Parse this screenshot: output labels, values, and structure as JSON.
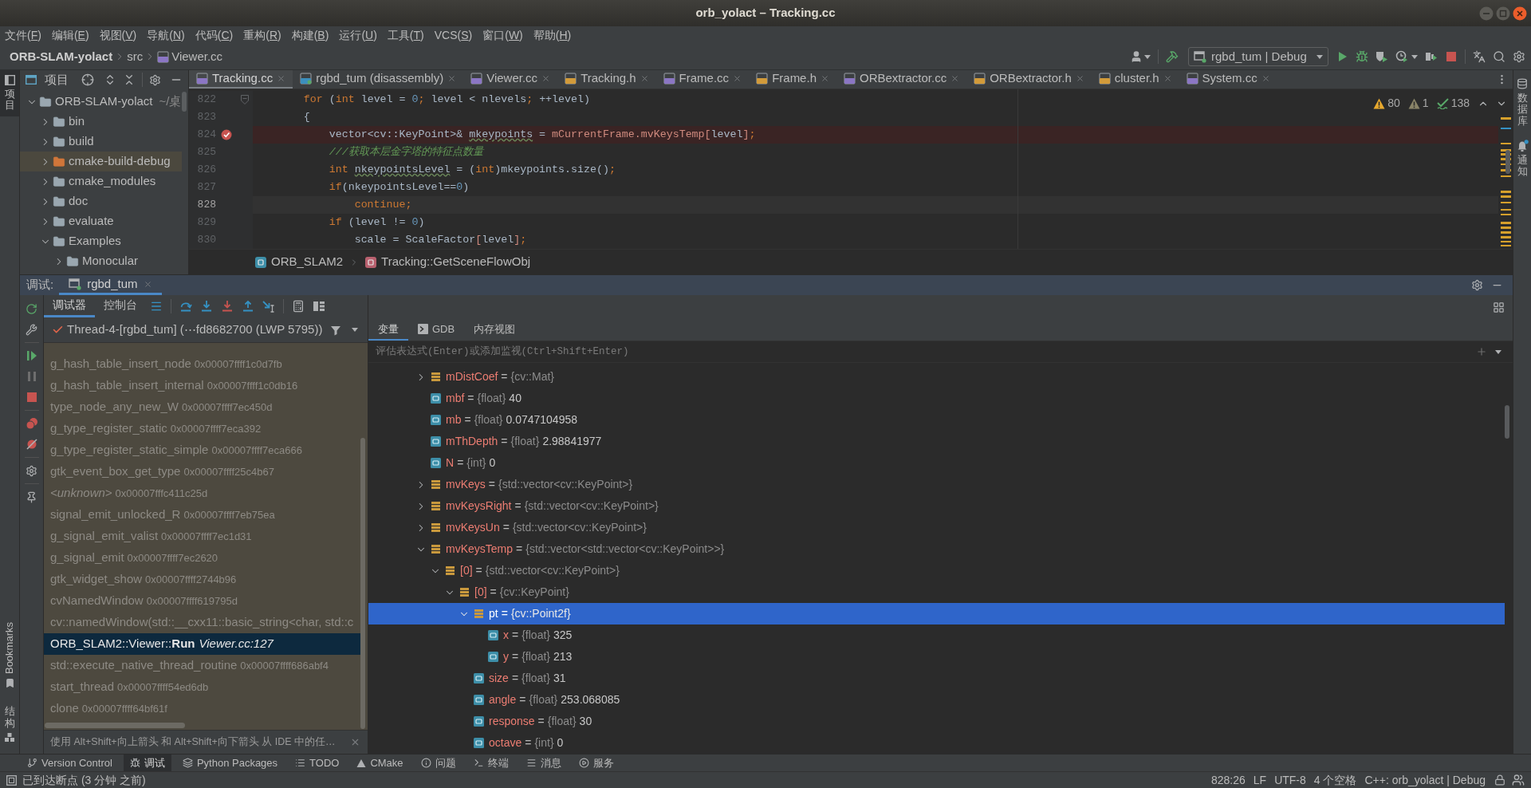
{
  "window": {
    "title": "orb_yolact – Tracking.cc"
  },
  "menu": [
    {
      "before": "文件(",
      "key": "F",
      "after": ")"
    },
    {
      "before": "编辑(",
      "key": "E",
      "after": ")"
    },
    {
      "before": "视图(",
      "key": "V",
      "after": ")"
    },
    {
      "before": "导航(",
      "key": "N",
      "after": ")"
    },
    {
      "before": "代码(",
      "key": "C",
      "after": ")"
    },
    {
      "before": "重构(",
      "key": "R",
      "after": ")"
    },
    {
      "before": "构建(",
      "key": "B",
      "after": ")"
    },
    {
      "before": "运行(",
      "key": "U",
      "after": ")"
    },
    {
      "before": "工具(",
      "key": "T",
      "after": ")"
    },
    {
      "before": "VCS(",
      "key": "S",
      "after": ")"
    },
    {
      "before": "窗口(",
      "key": "W",
      "after": ")"
    },
    {
      "before": "帮助(",
      "key": "H",
      "after": ")"
    }
  ],
  "navbar": {
    "crumbs": [
      {
        "label": "ORB-SLAM-yolact",
        "kind": "project"
      },
      {
        "label": "src",
        "kind": "folder"
      },
      {
        "label": "Viewer.cc",
        "kind": "cpp"
      }
    ],
    "run_config": "rgbd_tum | Debug"
  },
  "left_strip": {
    "top": [
      {
        "label": "项目",
        "selected": true
      }
    ],
    "bottom": [
      {
        "label": "Bookmarks",
        "kind": "bookmarks"
      },
      {
        "label": "结构",
        "kind": "structure"
      }
    ]
  },
  "project": {
    "title": "项目",
    "tree": [
      {
        "label": "ORB-SLAM-yolact",
        "path": "~/桌",
        "expanded": true,
        "excluded": false,
        "selected": false,
        "children": [
          {
            "label": "bin",
            "expanded": false,
            "excluded": false,
            "selected": false
          },
          {
            "label": "build",
            "expanded": false,
            "excluded": false,
            "selected": false
          },
          {
            "label": "cmake-build-debug",
            "expanded": false,
            "excluded": true,
            "selected": false
          },
          {
            "label": "cmake_modules",
            "expanded": false,
            "excluded": false,
            "selected": false
          },
          {
            "label": "doc",
            "expanded": false,
            "excluded": false,
            "selected": false
          },
          {
            "label": "evaluate",
            "expanded": false,
            "excluded": false,
            "selected": false
          },
          {
            "label": "Examples",
            "expanded": true,
            "excluded": false,
            "selected": false,
            "children": [
              {
                "label": "Monocular",
                "expanded": false,
                "excluded": false,
                "selected": false
              }
            ]
          }
        ]
      }
    ]
  },
  "editor": {
    "tabs": [
      {
        "label": "Tracking.cc",
        "kind": "cpp",
        "selected": true
      },
      {
        "label": "rgbd_tum (disassembly)",
        "kind": "disasm",
        "selected": false
      },
      {
        "label": "Viewer.cc",
        "kind": "cpp",
        "selected": false
      },
      {
        "label": "Tracking.h",
        "kind": "h",
        "selected": false
      },
      {
        "label": "Frame.cc",
        "kind": "cpp",
        "selected": false
      },
      {
        "label": "Frame.h",
        "kind": "h",
        "selected": false
      },
      {
        "label": "ORBextractor.cc",
        "kind": "cpp",
        "selected": false
      },
      {
        "label": "ORBextractor.h",
        "kind": "h",
        "selected": false
      },
      {
        "label": "cluster.h",
        "kind": "h",
        "selected": false
      },
      {
        "label": "System.cc",
        "kind": "cpp",
        "selected": false
      }
    ],
    "inspections": [
      {
        "kind": "warning",
        "count": "80"
      },
      {
        "kind": "weak_warning",
        "count": "1"
      },
      {
        "kind": "typo",
        "count": "138"
      }
    ],
    "lines": [
      {
        "number": "822",
        "breakpoint": false,
        "caret": false,
        "fold": true,
        "code": [
          {
            "text": "        for",
            "kind": "keyword"
          },
          {
            "text": " (",
            "kind": "plain"
          },
          {
            "text": "int",
            "kind": "keyword"
          },
          {
            "text": " level = ",
            "kind": "plain"
          },
          {
            "text": "0",
            "kind": "number"
          },
          {
            "text": ";",
            "kind": "keyword"
          },
          {
            "text": " level < nlevels",
            "kind": "plain"
          },
          {
            "text": ";",
            "kind": "keyword"
          },
          {
            "text": " ++level)",
            "kind": "plain"
          }
        ]
      },
      {
        "number": "823",
        "breakpoint": false,
        "caret": false,
        "fold": false,
        "code": [
          {
            "text": "        {",
            "kind": "plain"
          }
        ]
      },
      {
        "number": "824",
        "breakpoint": true,
        "caret": false,
        "fold": false,
        "code": [
          {
            "text": "            vector<cv::KeyPoint>& ",
            "kind": "plain"
          },
          {
            "text": "mkeypoints",
            "kind": "typo"
          },
          {
            "text": " = ",
            "kind": "plain"
          },
          {
            "text": "mCurrentFrame.mvKeysTemp[",
            "kind": "field"
          },
          {
            "text": "level",
            "kind": "plain"
          },
          {
            "text": "]",
            "kind": "field"
          },
          {
            "text": ";",
            "kind": "keyword"
          }
        ]
      },
      {
        "number": "825",
        "breakpoint": false,
        "caret": false,
        "fold": false,
        "code": [
          {
            "text": "            ///获取本层金字塔的特征点数量",
            "kind": "comment"
          }
        ]
      },
      {
        "number": "826",
        "breakpoint": false,
        "caret": false,
        "fold": false,
        "code": [
          {
            "text": "            int ",
            "kind": "keyword"
          },
          {
            "text": "nkeypointsLevel",
            "kind": "typo"
          },
          {
            "text": " = (",
            "kind": "plain"
          },
          {
            "text": "int",
            "kind": "keyword"
          },
          {
            "text": ")mkeypoints.size()",
            "kind": "plain"
          },
          {
            "text": ";",
            "kind": "keyword"
          }
        ]
      },
      {
        "number": "827",
        "breakpoint": false,
        "caret": false,
        "fold": false,
        "code": [
          {
            "text": "            if",
            "kind": "keyword"
          },
          {
            "text": "(nkeypointsLevel==",
            "kind": "plain"
          },
          {
            "text": "0",
            "kind": "number"
          },
          {
            "text": ")",
            "kind": "plain"
          }
        ]
      },
      {
        "number": "828",
        "breakpoint": false,
        "caret": true,
        "fold": false,
        "code": [
          {
            "text": "                continue;",
            "kind": "keyword"
          }
        ]
      },
      {
        "number": "829",
        "breakpoint": false,
        "caret": false,
        "fold": false,
        "code": [
          {
            "text": "            if",
            "kind": "keyword"
          },
          {
            "text": " (level != ",
            "kind": "plain"
          },
          {
            "text": "0",
            "kind": "number"
          },
          {
            "text": ")",
            "kind": "plain"
          }
        ]
      },
      {
        "number": "830",
        "breakpoint": false,
        "caret": false,
        "fold": false,
        "code": [
          {
            "text": "                scale = ScaleFactor",
            "kind": "plain"
          },
          {
            "text": "[",
            "kind": "field"
          },
          {
            "text": "level",
            "kind": "plain"
          },
          {
            "text": "]",
            "kind": "field"
          },
          {
            "text": ";",
            "kind": "keyword"
          }
        ]
      }
    ],
    "breadcrumbs": [
      {
        "label": "ORB_SLAM2",
        "kind": "namespace"
      },
      {
        "label": "Tracking::GetSceneFlowObj",
        "kind": "function"
      }
    ]
  },
  "debug": {
    "title": "调试:",
    "sessions": [
      {
        "label": "rgbd_tum",
        "selected": true
      }
    ],
    "panel_tabs": [
      {
        "label": "调试器",
        "selected": true
      },
      {
        "label": "控制台",
        "selected": false
      }
    ],
    "thread": "Thread-4-[rgbd_tum] (⋯fd8682700 (LWP 5795))",
    "frames": [
      {
        "kind": "library",
        "function": "g_hash_table_insert_node",
        "address": "0x00007ffff1c0d7fb",
        "selected": false
      },
      {
        "kind": "library",
        "function": "g_hash_table_insert_internal",
        "address": "0x00007ffff1c0db16",
        "selected": false
      },
      {
        "kind": "library",
        "function": "type_node_any_new_W",
        "address": "0x00007ffff7ec450d",
        "selected": false
      },
      {
        "kind": "library",
        "function": "g_type_register_static",
        "address": "0x00007ffff7eca392",
        "selected": false
      },
      {
        "kind": "library",
        "function": "g_type_register_static_simple",
        "address": "0x00007ffff7eca666",
        "selected": false
      },
      {
        "kind": "library",
        "function": "gtk_event_box_get_type",
        "address": "0x00007ffff25c4b67",
        "selected": false
      },
      {
        "kind": "unknown",
        "function": "<unknown>",
        "address": "0x00007fffc411c25d",
        "selected": false
      },
      {
        "kind": "library",
        "function": "signal_emit_unlocked_R",
        "address": "0x00007ffff7eb75ea",
        "selected": false
      },
      {
        "kind": "library",
        "function": "g_signal_emit_valist",
        "address": "0x00007ffff7ec1d31",
        "selected": false
      },
      {
        "kind": "library",
        "function": "g_signal_emit",
        "address": "0x00007ffff7ec2620",
        "selected": false
      },
      {
        "kind": "library",
        "function": "gtk_widget_show",
        "address": "0x00007ffff2744b96",
        "selected": false
      },
      {
        "kind": "library",
        "function": "cvNamedWindow",
        "address": "0x00007ffff619795d",
        "selected": false
      },
      {
        "kind": "library",
        "function": "cv::namedWindow(std::__cxx11::basic_string<char, std::c",
        "selected": false
      },
      {
        "kind": "source",
        "function": "ORB_SLAM2::Viewer::**Run**",
        "location": "Viewer.cc:127",
        "selected": true
      },
      {
        "kind": "library",
        "function": "std::execute_native_thread_routine",
        "address": "0x00007ffff686abf4",
        "selected": false
      },
      {
        "kind": "library",
        "function": "start_thread",
        "address": "0x00007ffff54ed6db",
        "selected": false
      },
      {
        "kind": "library",
        "function": "clone",
        "address": "0x00007ffff64bf61f",
        "selected": false
      }
    ],
    "hint": "使用 Alt+Shift+向上箭头 和 Alt+Shift+向下箭头 从 IDE 中的任…",
    "variable_tabs": [
      {
        "label": "变量",
        "kind": "plain",
        "selected": true
      },
      {
        "label": "GDB",
        "kind": "console",
        "selected": false
      },
      {
        "label": "内存视图",
        "kind": "plain",
        "selected": false
      }
    ],
    "eval_placeholder": "评估表达式(Enter)或添加监视(Ctrl+Shift+Enter)",
    "variables": [
      {
        "name": "mDistCoef",
        "op": "=",
        "type": "{cv::Mat}",
        "kind": "object",
        "expanded": false,
        "selected": false
      },
      {
        "name": "mbf",
        "op": "=",
        "type": "{float}",
        "value": "40",
        "kind": "primitive",
        "selected": false
      },
      {
        "name": "mb",
        "op": "=",
        "type": "{float}",
        "value": "0.0747104958",
        "kind": "primitive",
        "selected": false
      },
      {
        "name": "mThDepth",
        "op": "=",
        "type": "{float}",
        "value": "2.98841977",
        "kind": "primitive",
        "selected": false
      },
      {
        "name": "N",
        "op": "=",
        "type": "{int}",
        "value": "0",
        "kind": "primitive",
        "selected": false
      },
      {
        "name": "mvKeys",
        "op": "=",
        "type": "{std::vector<cv::KeyPoint>}",
        "kind": "object",
        "expanded": false,
        "selected": false
      },
      {
        "name": "mvKeysRight",
        "op": "=",
        "type": "{std::vector<cv::KeyPoint>}",
        "kind": "object",
        "expanded": false,
        "selected": false
      },
      {
        "name": "mvKeysUn",
        "op": "=",
        "type": "{std::vector<cv::KeyPoint>}",
        "kind": "object",
        "expanded": false,
        "selected": false
      },
      {
        "name": "mvKeysTemp",
        "op": "=",
        "type": "{std::vector<std::vector<cv::KeyPoint>>}",
        "kind": "object",
        "expanded": true,
        "selected": false,
        "children": [
          {
            "name": "[0]",
            "op": "=",
            "type": "{std::vector<cv::KeyPoint>}",
            "kind": "object",
            "expanded": true,
            "selected": false,
            "children": [
              {
                "name": "[0]",
                "op": "=",
                "type": "{cv::KeyPoint}",
                "kind": "object",
                "expanded": true,
                "selected": false,
                "children": [
                  {
                    "name": "pt",
                    "op": "=",
                    "type": "{cv::Point2f}",
                    "kind": "object",
                    "expanded": true,
                    "selected": true,
                    "children": [
                      {
                        "name": "x",
                        "op": "=",
                        "type": "{float}",
                        "value": "325",
                        "kind": "primitive",
                        "selected": false
                      },
                      {
                        "name": "y",
                        "op": "=",
                        "type": "{float}",
                        "value": "213",
                        "kind": "primitive",
                        "selected": false
                      }
                    ]
                  },
                  {
                    "name": "size",
                    "op": "=",
                    "type": "{float}",
                    "value": "31",
                    "kind": "primitive",
                    "selected": false
                  },
                  {
                    "name": "angle",
                    "op": "=",
                    "type": "{float}",
                    "value": "253.068085",
                    "kind": "primitive",
                    "selected": false
                  },
                  {
                    "name": "response",
                    "op": "=",
                    "type": "{float}",
                    "value": "30",
                    "kind": "primitive",
                    "selected": false
                  },
                  {
                    "name": "octave",
                    "op": "=",
                    "type": "{int}",
                    "value": "0",
                    "kind": "primitive",
                    "selected": false
                  }
                ]
              }
            ]
          }
        ]
      }
    ]
  },
  "right_strip": [
    {
      "label": "数据库",
      "kind": "database"
    },
    {
      "label": "通知",
      "kind": "notifications"
    }
  ],
  "tool_tabs": [
    {
      "label": "Version Control",
      "kind": "vcs",
      "selected": false
    },
    {
      "label": "调试",
      "kind": "debug",
      "selected": true
    },
    {
      "label": "Python Packages",
      "kind": "packages",
      "selected": false
    },
    {
      "label": "TODO",
      "kind": "todo",
      "selected": false
    },
    {
      "label": "CMake",
      "kind": "cmake",
      "selected": false
    },
    {
      "label": "问题",
      "kind": "problems",
      "selected": false
    },
    {
      "label": "终端",
      "kind": "terminal",
      "selected": false
    },
    {
      "label": "消息",
      "kind": "messages",
      "selected": false
    },
    {
      "label": "服务",
      "kind": "services",
      "selected": false
    }
  ],
  "status_bar": {
    "message": "已到达断点 (3 分钟 之前)",
    "items": [
      "828:26",
      "LF",
      "UTF-8",
      "4 个空格",
      "C++: orb_yolact | Debug"
    ]
  }
}
